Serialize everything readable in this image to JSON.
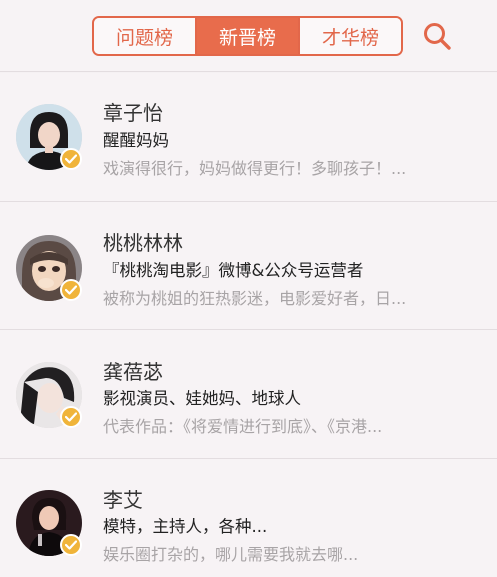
{
  "tabs": [
    {
      "label": "问题榜",
      "active": false
    },
    {
      "label": "新晋榜",
      "active": true
    },
    {
      "label": "才华榜",
      "active": false
    }
  ],
  "search": {
    "icon": "search-icon"
  },
  "colors": {
    "accent": "#e86c4c",
    "badge": "#f0b43a",
    "desc": "#a8a4a6"
  },
  "users": [
    {
      "name": "章子怡",
      "title": "醒醒妈妈",
      "desc": "戏演得很行，妈妈做得更行！多聊孩子！..."
    },
    {
      "name": "桃桃林林",
      "title": "『桃桃淘电影』微博&公众号运营者",
      "desc": "被称为桃姐的狂热影迷，电影爱好者，日..."
    },
    {
      "name": "龚蓓苾",
      "title": "影视演员、娃她妈、地球人",
      "desc": "代表作品：《将爱情进行到底》、《京港..."
    },
    {
      "name": "李艾",
      "title": "模特，主持人，各种...",
      "desc": "娱乐圈打杂的，哪儿需要我就去哪..."
    }
  ]
}
